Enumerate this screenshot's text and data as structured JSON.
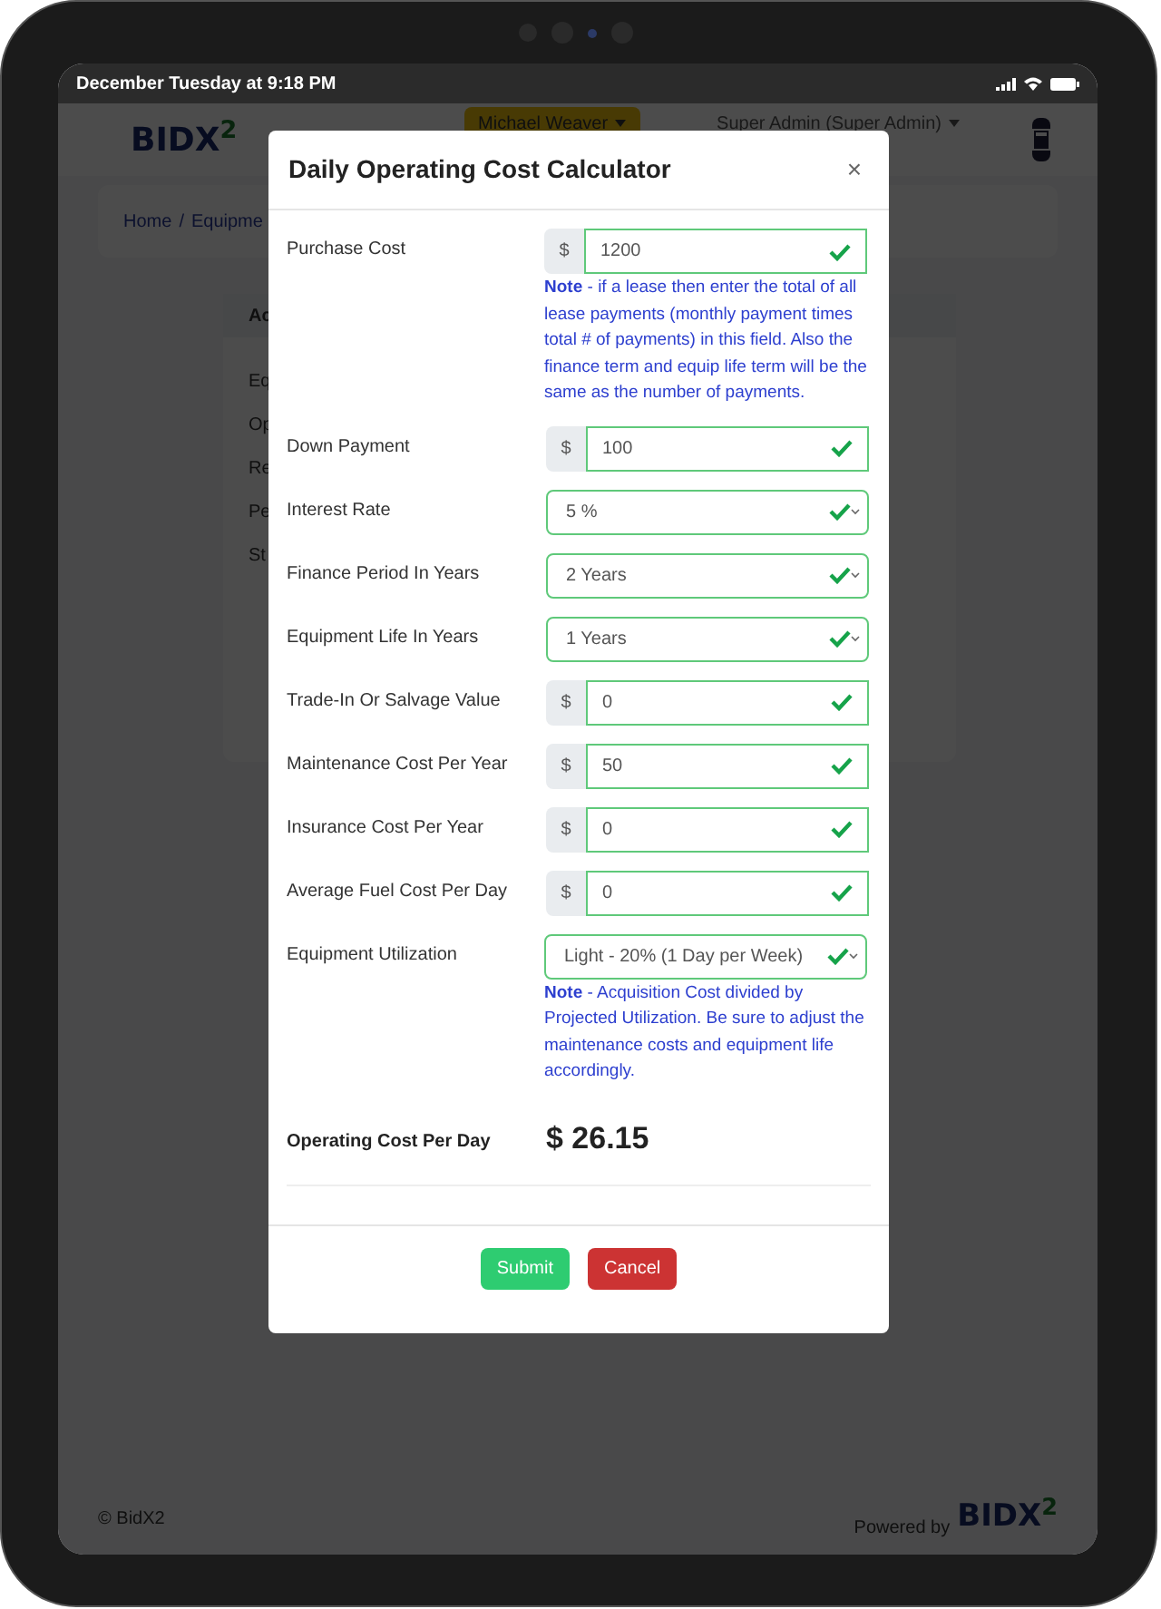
{
  "status_bar": {
    "time": "December Tuesday at 9:18 PM"
  },
  "header": {
    "logo": "BIDX",
    "logo_sup": "2",
    "user_menu": "Michael Weaver",
    "role_menu": "Super Admin (Super Admin)"
  },
  "breadcrumb": [
    "Home",
    "/",
    "Equipme"
  ],
  "background_card": {
    "title": "Ac",
    "labels": [
      "Eq",
      "Op",
      "Re",
      "Pe",
      "St"
    ]
  },
  "modal": {
    "title": "Daily Operating Cost Calculator",
    "close": "×",
    "fields": [
      {
        "label": "Purchase Cost",
        "kind": "currency",
        "prefix": "$",
        "value": "1200",
        "valid": true,
        "note": "**Note** - if a lease then enter the total of all lease payments (monthly payment times total # of payments) in this field. Also the finance term and equip life term will be the same as the number of payments."
      },
      {
        "label": "Down Payment",
        "kind": "currency",
        "prefix": "$",
        "value": "100",
        "valid": true
      },
      {
        "label": "Interest Rate",
        "kind": "select",
        "value": "5 %",
        "valid": true
      },
      {
        "label": "Finance Period In Years",
        "kind": "select",
        "value": "2 Years",
        "valid": true
      },
      {
        "label": "Equipment Life In Years",
        "kind": "select",
        "value": "1 Years",
        "valid": true
      },
      {
        "label": "Trade-In Or Salvage Value",
        "kind": "currency",
        "prefix": "$",
        "value": "0",
        "valid": true
      },
      {
        "label": "Maintenance Cost Per Year",
        "kind": "currency",
        "prefix": "$",
        "value": "50",
        "valid": true
      },
      {
        "label": "Insurance Cost Per Year",
        "kind": "currency",
        "prefix": "$",
        "value": "0",
        "valid": true
      },
      {
        "label": "Average Fuel Cost Per Day",
        "kind": "currency",
        "prefix": "$",
        "value": "0",
        "valid": true
      },
      {
        "label": "Equipment Utilization",
        "kind": "select",
        "value": "Light - 20% (1 Day per Week)",
        "valid": true,
        "note": "**Note** - Acquisition Cost divided by Projected Utilization. Be sure to adjust the maintenance costs and equipment life accordingly."
      }
    ],
    "result": {
      "label": "Operating Cost Per Day",
      "value": "$ 26.15"
    },
    "buttons": [
      {
        "label": "Submit",
        "kind": "submit"
      },
      {
        "label": "Cancel",
        "kind": "cancel"
      }
    ]
  },
  "footer": {
    "copyright": "© BidX2",
    "powered_by": "Powered by",
    "logo": "BIDX",
    "logo_sup": "2"
  }
}
